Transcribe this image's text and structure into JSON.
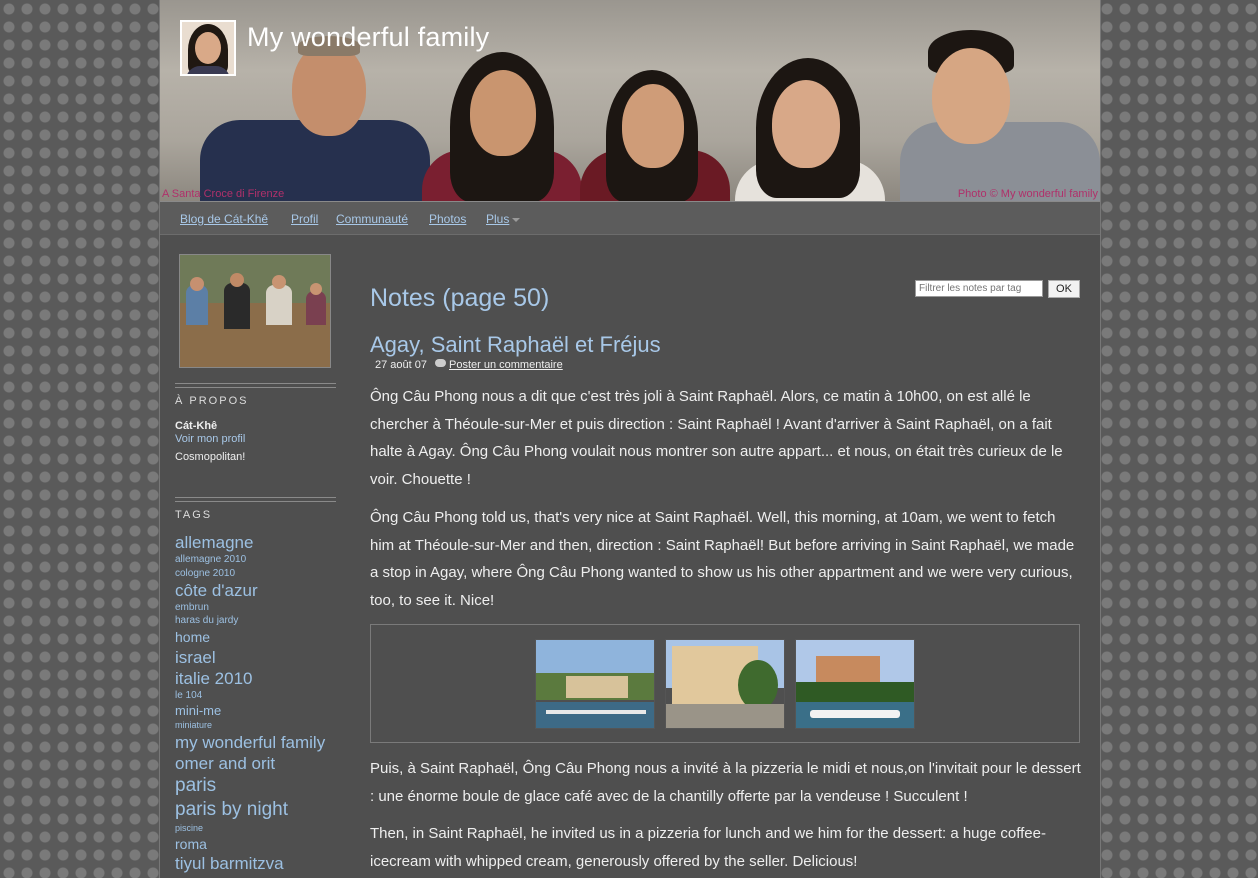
{
  "header": {
    "site_title": "My wonderful family",
    "caption_left": "A Santa Croce di Firenze",
    "caption_right": "Photo © My wonderful family"
  },
  "nav": {
    "items": [
      {
        "label": "Blog de Cát-Khê"
      },
      {
        "label": "Profil"
      },
      {
        "label": "Communauté"
      },
      {
        "label": "Photos"
      },
      {
        "label": "Plus"
      }
    ]
  },
  "sidebar": {
    "about_heading": "À PROPOS",
    "about_name": "Cát-Khê",
    "about_link": "Voir mon profil",
    "about_desc": "Cosmopolitan!",
    "tags_heading": "TAGS",
    "tags": [
      "allemagne",
      "allemagne 2010",
      "cologne 2010",
      "côte d'azur",
      "embrun",
      "haras du jardy",
      "home",
      "israel",
      "italie 2010",
      "le 104",
      "mini-me",
      "miniature",
      "my wonderful family",
      "omer and orit",
      "paris",
      "paris by night",
      "piscine",
      "roma",
      "tiyul barmitzva"
    ]
  },
  "filter": {
    "placeholder": "Filtrer les notes par tag",
    "button": "OK"
  },
  "main": {
    "page_title": "Notes (page 50)",
    "post_title": "Agay, Saint Raphaël et Fréjus",
    "post_date": "27 août 07",
    "comment_link": "Poster un commentaire",
    "paragraphs": [
      "Ông Câu Phong nous a dit que c'est très joli à Saint Raphaël. Alors, ce matin à 10h00, on est allé le chercher à Théoule-sur-Mer et puis direction : Saint Raphaël ! Avant d'arriver à Saint Raphaël,  on a fait halte à Agay. Ông Câu Phong  voulait nous montrer son autre appart... et nous, on était très curieux de le voir. Chouette !",
      "Ông Câu Phong told us, that's very nice at Saint Raphaël. Well, this morning, at 10am, we went to fetch him at Théoule-sur-Mer and then, direction : Saint Raphaël! But before arriving in Saint Raphaël, we made a stop in Agay, where Ông Câu Phong wanted to show us his other appartment and we were very curious, too, to see it. Nice!",
      "Puis, à Saint Raphaël, Ông Câu Phong nous a invité à la pizzeria le midi et nous,on l'invitait pour le dessert : une énorme boule de glace café avec de la chantilly offerte par la vendeuse ! Succulent !",
      "Then, in Saint Raphaël, he invited us in a pizzeria for lunch and we him for the dessert: a huge coffee-icecream with whipped cream, generously offered by the seller. Delicious!"
    ]
  }
}
